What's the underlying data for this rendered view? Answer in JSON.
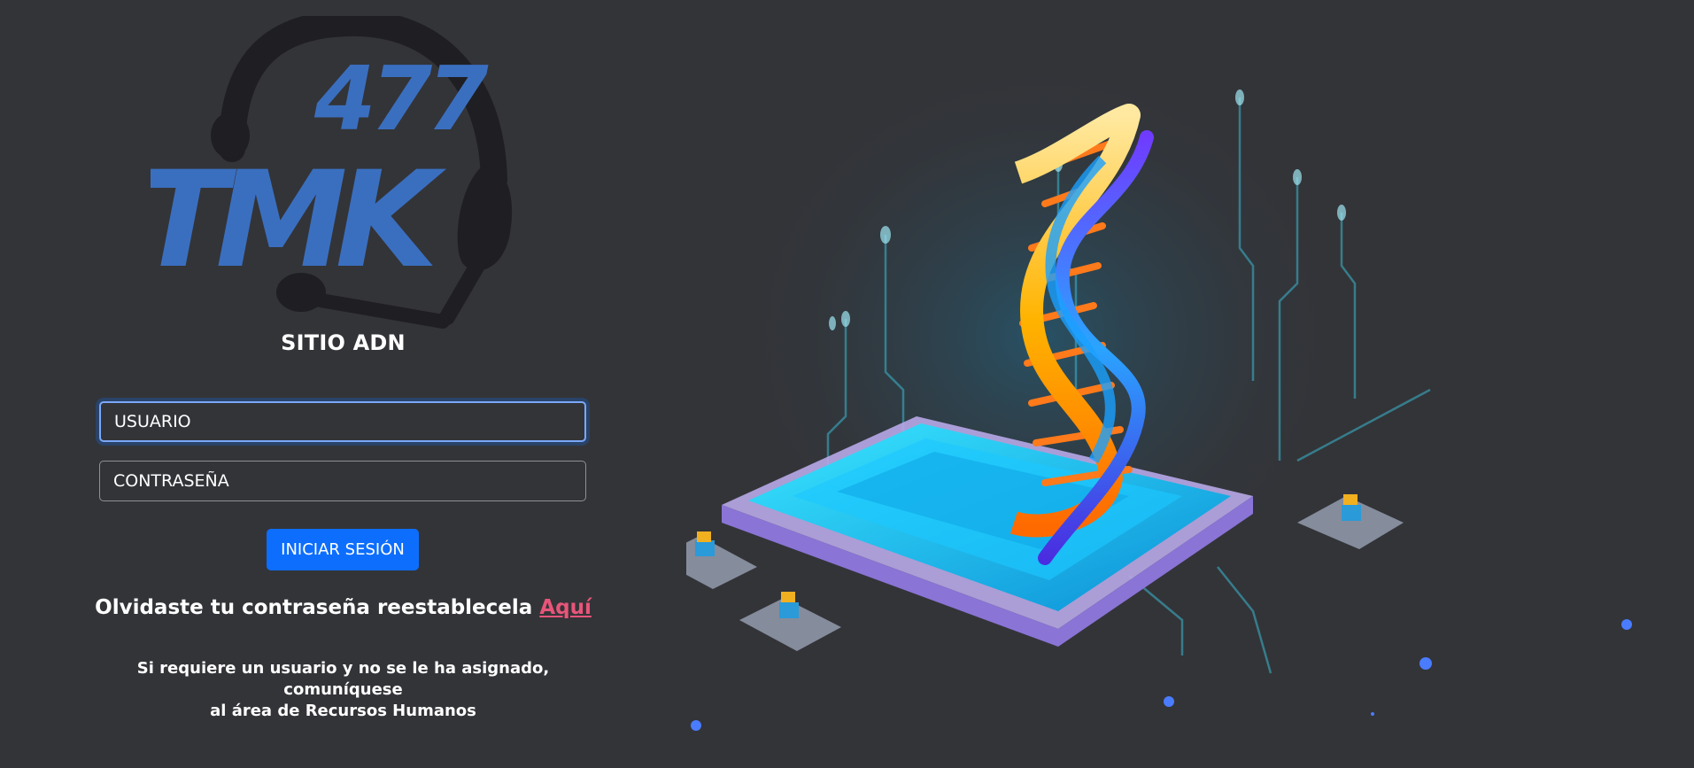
{
  "logo": {
    "number": "477",
    "brand": "TMK",
    "icon": "headset-icon",
    "brand_color": "#3a6fc0"
  },
  "site_title": "SITIO ADN",
  "form": {
    "user_placeholder": "USUARIO",
    "password_placeholder": "CONTRASEÑA",
    "login_label": "INICIAR SESIÓN",
    "login_color": "#0d6efd"
  },
  "forgot": {
    "text": "Olvidaste tu contraseña reestablecela",
    "link_label": "Aquí",
    "link_color": "#e8557a"
  },
  "note": {
    "line1": "Si requiere un usuario y no se le ha asignado, comuníquese",
    "line2": "al área de Recursos Humanos"
  },
  "illustration": {
    "icon": "dna-chip-illustration"
  }
}
